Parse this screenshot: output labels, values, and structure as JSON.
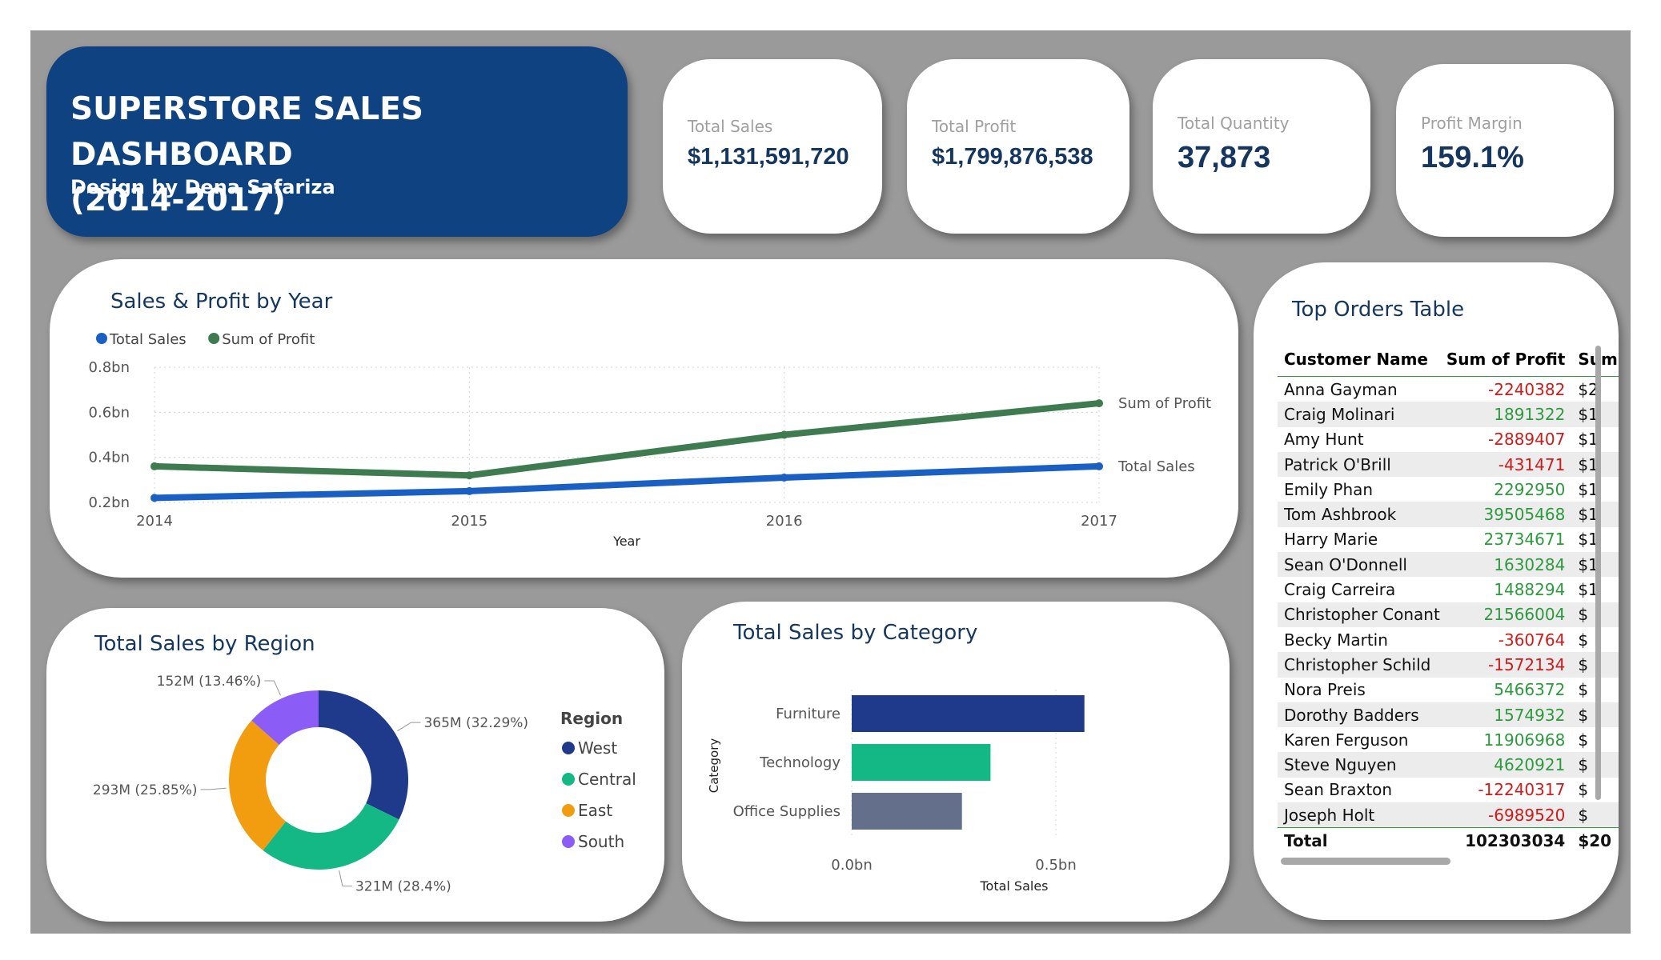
{
  "title": {
    "line1": "SUPERSTORE SALES DASHBOARD",
    "line2": "(2014-2017)",
    "subtitle": "Design by Dena Safariza"
  },
  "kpis": [
    {
      "label": "Total Sales",
      "value": "$1,131,591,720"
    },
    {
      "label": "Total Profit",
      "value": "$1,799,876,538"
    },
    {
      "label": "Total Quantity",
      "value": "37,873"
    },
    {
      "label": "Profit Margin",
      "value": "159.1%"
    }
  ],
  "colors": {
    "navy": "#0f4280",
    "sales_line": "#1a5fc4",
    "profit_line": "#3f7b50",
    "west": "#1f3a8a",
    "central": "#14b885",
    "east": "#f29d0f",
    "south": "#8b5cf6",
    "furniture": "#1f3a8a",
    "technology": "#14b885",
    "office": "#64708b"
  },
  "chart_data": [
    {
      "type": "line",
      "title": "Sales & Profit by Year",
      "x": [
        "2014",
        "2015",
        "2016",
        "2017"
      ],
      "xlabel": "Year",
      "ylabel": "",
      "ylim": [
        0.2,
        0.8
      ],
      "yticks": [
        "0.2bn",
        "0.4bn",
        "0.6bn",
        "0.8bn"
      ],
      "grid": true,
      "legend": "top-left",
      "series": [
        {
          "name": "Total Sales",
          "values": [
            0.22,
            0.25,
            0.31,
            0.36
          ]
        },
        {
          "name": "Sum of Profit",
          "values": [
            0.36,
            0.32,
            0.5,
            0.64
          ]
        }
      ]
    },
    {
      "type": "pie",
      "title": "Total Sales by Region",
      "legend_title": "Region",
      "legend": "right",
      "slices": [
        {
          "name": "West",
          "value": 365,
          "label": "365M (32.29%)"
        },
        {
          "name": "Central",
          "value": 321,
          "label": "321M (28.4%)"
        },
        {
          "name": "East",
          "value": 293,
          "label": "293M (25.85%)"
        },
        {
          "name": "South",
          "value": 152,
          "label": "152M (13.46%)"
        }
      ]
    },
    {
      "type": "bar",
      "orientation": "horizontal",
      "title": "Total Sales by Category",
      "categories": [
        "Furniture",
        "Technology",
        "Office Supplies"
      ],
      "values": [
        0.57,
        0.34,
        0.27
      ],
      "xlabel": "Total Sales",
      "ylabel": "Category",
      "xlim": [
        0,
        0.6
      ],
      "xticks": [
        "0.0bn",
        "0.5bn"
      ]
    },
    {
      "type": "table",
      "title": "Top Orders Table",
      "columns": [
        "Customer Name",
        "Sum of Profit",
        "Sum"
      ],
      "rows": [
        {
          "name": "Anna Gayman",
          "profit": "-2240382",
          "sum": "$2"
        },
        {
          "name": "Craig Molinari",
          "profit": "1891322",
          "sum": "$1"
        },
        {
          "name": "Amy Hunt",
          "profit": "-2889407",
          "sum": "$1"
        },
        {
          "name": "Patrick O'Brill",
          "profit": "-431471",
          "sum": "$1"
        },
        {
          "name": "Emily Phan",
          "profit": "2292950",
          "sum": "$1"
        },
        {
          "name": "Tom Ashbrook",
          "profit": "39505468",
          "sum": "$1"
        },
        {
          "name": "Harry Marie",
          "profit": "23734671",
          "sum": "$1"
        },
        {
          "name": "Sean O'Donnell",
          "profit": "1630284",
          "sum": "$1"
        },
        {
          "name": "Craig Carreira",
          "profit": "1488294",
          "sum": "$1"
        },
        {
          "name": "Christopher Conant",
          "profit": "21566004",
          "sum": "$"
        },
        {
          "name": "Becky Martin",
          "profit": "-360764",
          "sum": "$"
        },
        {
          "name": "Christopher Schild",
          "profit": "-1572134",
          "sum": "$"
        },
        {
          "name": "Nora Preis",
          "profit": "5466372",
          "sum": "$"
        },
        {
          "name": "Dorothy Badders",
          "profit": "1574932",
          "sum": "$"
        },
        {
          "name": "Karen Ferguson",
          "profit": "11906968",
          "sum": "$"
        },
        {
          "name": "Steve Nguyen",
          "profit": "4620921",
          "sum": "$"
        },
        {
          "name": "Sean Braxton",
          "profit": "-12240317",
          "sum": "$"
        },
        {
          "name": "Joseph Holt",
          "profit": "-6989520",
          "sum": "$"
        }
      ],
      "total": {
        "label": "Total",
        "profit": "102303034",
        "sum": "$20"
      }
    }
  ]
}
